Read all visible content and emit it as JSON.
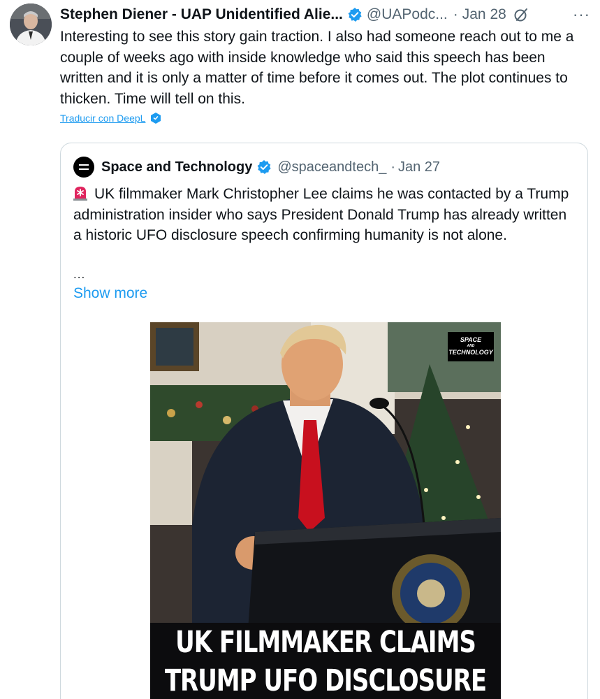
{
  "tweet": {
    "author_name": "Stephen Diener - UAP Unidentified Alie...",
    "handle": "@UAPodc...",
    "separator": "·",
    "date": "Jan 28",
    "more_label": "···",
    "text": "Interesting to see this story gain traction. I also had someone reach out to me a couple of weeks ago with inside knowledge who said this speech has been written and it is only a matter of time before it comes out. The plot continues to thicken. Time will tell on this.",
    "translate_label": "Traducir con DeepL",
    "icons": {
      "verified": "verified-badge-icon",
      "grok": "grok-icon",
      "deepl": "deepl-icon"
    }
  },
  "quoted": {
    "author_name": "Space and Technology",
    "handle": "@spaceandtech_",
    "separator": "·",
    "date": "Jan 27",
    "text": "UK filmmaker Mark Christopher Lee claims he was contacted by a Trump administration insider who says President Donald Trump has already written a historic UFO disclosure speech confirming humanity is not alone.",
    "ellipsis": "...",
    "show_more_label": "Show more",
    "media": {
      "caption_line1": "UK FILMMAKER CLAIMS",
      "caption_line2": "TRUMP UFO DISCLOSURE",
      "watermark_line1": "SPACE",
      "watermark_line2": "AND",
      "watermark_line3": "TECHNOLOGY"
    },
    "icons": {
      "siren": "siren-emoji-icon",
      "verified": "verified-badge-icon"
    }
  },
  "colors": {
    "link_blue": "#1d9bf0",
    "verified_blue": "#1d9bf0",
    "secondary_text": "#536471",
    "primary_text": "#0f1419",
    "border": "#cfd9de"
  }
}
